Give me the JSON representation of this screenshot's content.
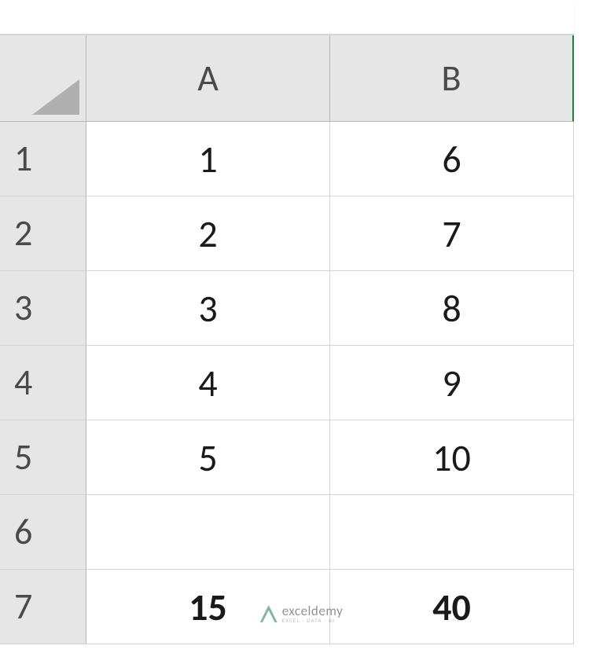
{
  "columns": [
    "A",
    "B"
  ],
  "rows": [
    "1",
    "2",
    "3",
    "4",
    "5",
    "6",
    "7"
  ],
  "cells": {
    "A1": "1",
    "B1": "6",
    "A2": "2",
    "B2": "7",
    "A3": "3",
    "B3": "8",
    "A4": "4",
    "B4": "9",
    "A5": "5",
    "B5": "10",
    "A6": "",
    "B6": "",
    "A7": "15",
    "B7": "40"
  },
  "bold_cells": [
    "A7",
    "B7"
  ],
  "watermark": {
    "title": "exceldemy",
    "subtitle": "EXCEL · DATA · BI"
  }
}
